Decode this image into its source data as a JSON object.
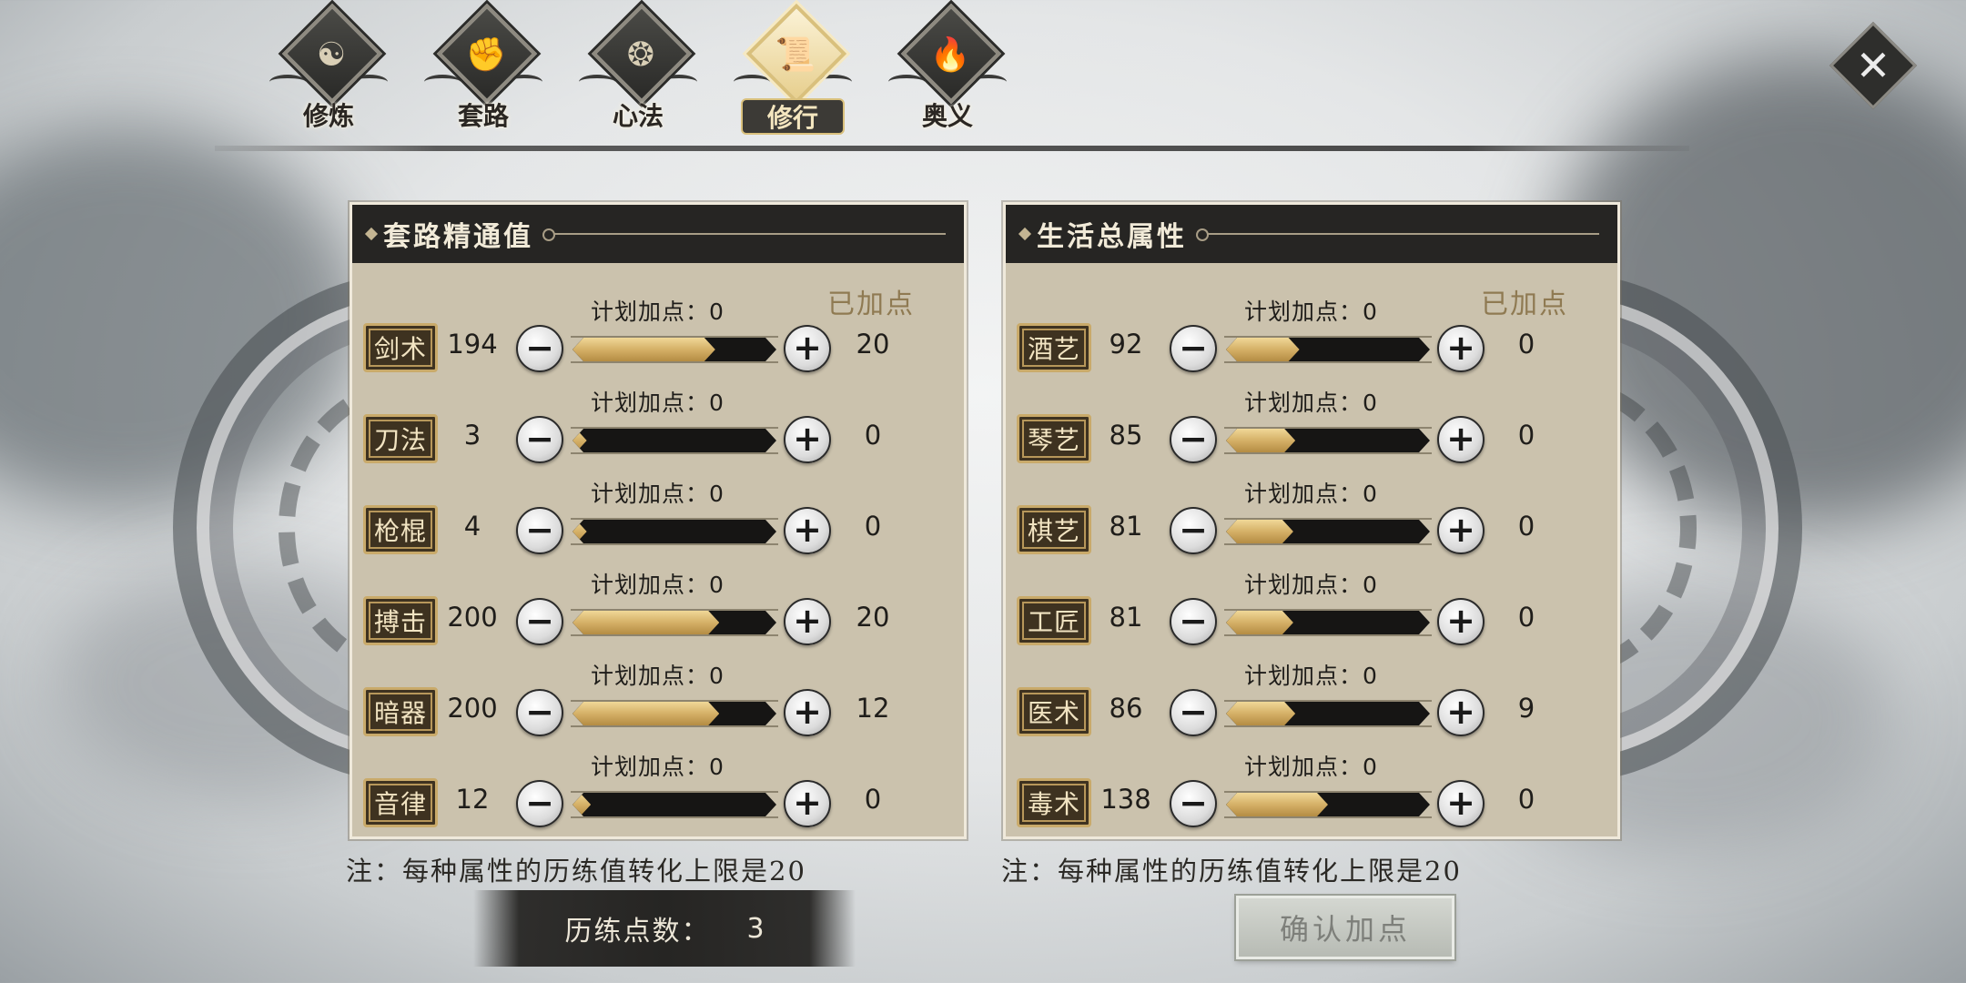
{
  "nav": {
    "tabs": [
      {
        "label": "修炼",
        "icon": "yin-yang-icon",
        "glyph": "☯"
      },
      {
        "label": "套路",
        "icon": "fist-icon",
        "glyph": "✊"
      },
      {
        "label": "心法",
        "icon": "swirl-icon",
        "glyph": "❂"
      },
      {
        "label": "修行",
        "icon": "scroll-icon",
        "glyph": "📜",
        "active": true
      },
      {
        "label": "奥义",
        "icon": "flame-icon",
        "glyph": "🔥"
      }
    ]
  },
  "close": {
    "glyph": "✕",
    "icon": "close-icon"
  },
  "left_panel": {
    "title": "套路精通值",
    "applied_header": "已加点",
    "rows": [
      {
        "name": "剑术",
        "value": "194",
        "plan": "计划加点：0",
        "fill": 0.7,
        "applied": "20"
      },
      {
        "name": "刀法",
        "value": "3",
        "plan": "计划加点：0",
        "fill": 0.07,
        "applied": "0"
      },
      {
        "name": "枪棍",
        "value": "4",
        "plan": "计划加点：0",
        "fill": 0.07,
        "applied": "0"
      },
      {
        "name": "搏击",
        "value": "200",
        "plan": "计划加点：0",
        "fill": 0.72,
        "applied": "20"
      },
      {
        "name": "暗器",
        "value": "200",
        "plan": "计划加点：0",
        "fill": 0.72,
        "applied": "12"
      },
      {
        "name": "音律",
        "value": "12",
        "plan": "计划加点：0",
        "fill": 0.09,
        "applied": "0"
      }
    ],
    "note": "注：每种属性的历练值转化上限是20"
  },
  "right_panel": {
    "title": "生活总属性",
    "applied_header": "已加点",
    "rows": [
      {
        "name": "酒艺",
        "value": "92",
        "plan": "计划加点：0",
        "fill": 0.36,
        "applied": "0"
      },
      {
        "name": "琴艺",
        "value": "85",
        "plan": "计划加点：0",
        "fill": 0.34,
        "applied": "0"
      },
      {
        "name": "棋艺",
        "value": "81",
        "plan": "计划加点：0",
        "fill": 0.33,
        "applied": "0"
      },
      {
        "name": "工匠",
        "value": "81",
        "plan": "计划加点：0",
        "fill": 0.33,
        "applied": "0"
      },
      {
        "name": "医术",
        "value": "86",
        "plan": "计划加点：0",
        "fill": 0.34,
        "applied": "9"
      },
      {
        "name": "毒术",
        "value": "138",
        "plan": "计划加点：0",
        "fill": 0.5,
        "applied": "0"
      }
    ],
    "note": "注：每种属性的历练值转化上限是20"
  },
  "points": {
    "label": "历练点数：",
    "value": "3"
  },
  "confirm": {
    "label": "确认加点"
  },
  "buttons": {
    "minus": "−",
    "plus": "+"
  }
}
